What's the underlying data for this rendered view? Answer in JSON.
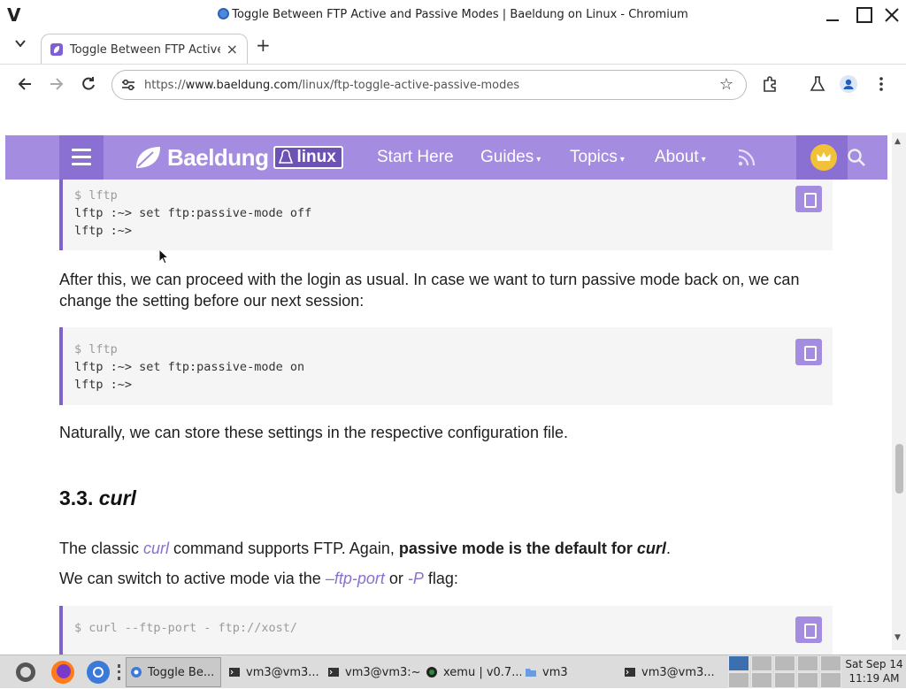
{
  "window": {
    "title": "Toggle Between FTP Active and Passive Modes | Baeldung on Linux - Chromium",
    "logo": "V"
  },
  "tabs": [
    {
      "label": "Toggle Between FTP Active a",
      "icon": "baeldung-favicon"
    }
  ],
  "toolbar": {
    "url_scheme": "https://",
    "url_host": "www.baeldung.com",
    "url_path": "/linux/ftp-toggle-active-passive-modes"
  },
  "site": {
    "brand": "Baeldung",
    "brand_sub": "linux",
    "nav": [
      "Start Here",
      "Guides",
      "Topics",
      "About"
    ],
    "accent": "#a48ce0"
  },
  "article": {
    "code1": [
      "$ lftp",
      "lftp :~> set ftp:passive-mode off",
      "lftp :~>"
    ],
    "p1": "After this, we can proceed with the login as usual. In case we want to turn passive mode back on, we can change the setting before our next session:",
    "code2": [
      "$ lftp",
      "lftp :~> set ftp:passive-mode on",
      "lftp :~>"
    ],
    "p2": "Naturally, we can store these settings in the respective configuration file.",
    "heading_num": "3.3.",
    "heading_cmd": "curl",
    "p3_a": "The classic ",
    "p3_link": "curl",
    "p3_b": " command supports FTP. Again, ",
    "p3_bold": "passive mode is the default for ",
    "p3_bold_cmd": "curl",
    "p3_end": ".",
    "p4_a": "We can switch to active mode via the ",
    "p4_link1": "–ftp-port",
    "p4_or": " or ",
    "p4_link2": "-P",
    "p4_b": " flag:",
    "code3": [
      "$ curl --ftp-port - ftp://xost/"
    ]
  },
  "taskbar": {
    "items": [
      {
        "label": "Toggle Be...",
        "icon": "chromium-icon",
        "active": true
      },
      {
        "label": "vm3@vm3...",
        "icon": "terminal-icon",
        "active": false
      },
      {
        "label": "vm3@vm3:~",
        "icon": "terminal-icon",
        "active": false
      },
      {
        "label": "xemu | v0.7...",
        "icon": "xemu-icon",
        "active": false
      },
      {
        "label": "vm3",
        "icon": "folder-icon",
        "active": false
      },
      {
        "label": "vm3@vm3...",
        "icon": "terminal-icon",
        "active": false
      }
    ],
    "clock_date": "Sat Sep 14",
    "clock_time": "11:19 AM"
  }
}
